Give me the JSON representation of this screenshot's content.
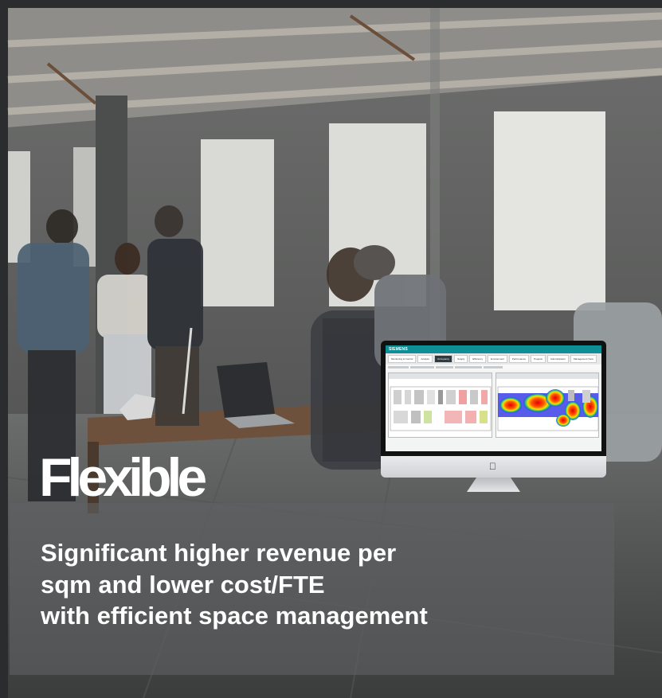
{
  "headline": "Flexible",
  "subtext_lines": [
    "Significant higher revenue per",
    "sqm and lower cost/FTE",
    "with efficient space management"
  ],
  "monitor": {
    "brand": "SIEMENS",
    "tabs": [
      "Monitoring & Control",
      "Analyze",
      "Occupancy",
      "Supply",
      "Efficiency",
      "Environment",
      "Performance",
      "Projects",
      "Administration",
      "Management View"
    ],
    "active_tab": "Occupancy"
  },
  "colors": {
    "banner": "#5f6163",
    "text": "#ffffff",
    "brand_teal": "#0e8f95"
  }
}
